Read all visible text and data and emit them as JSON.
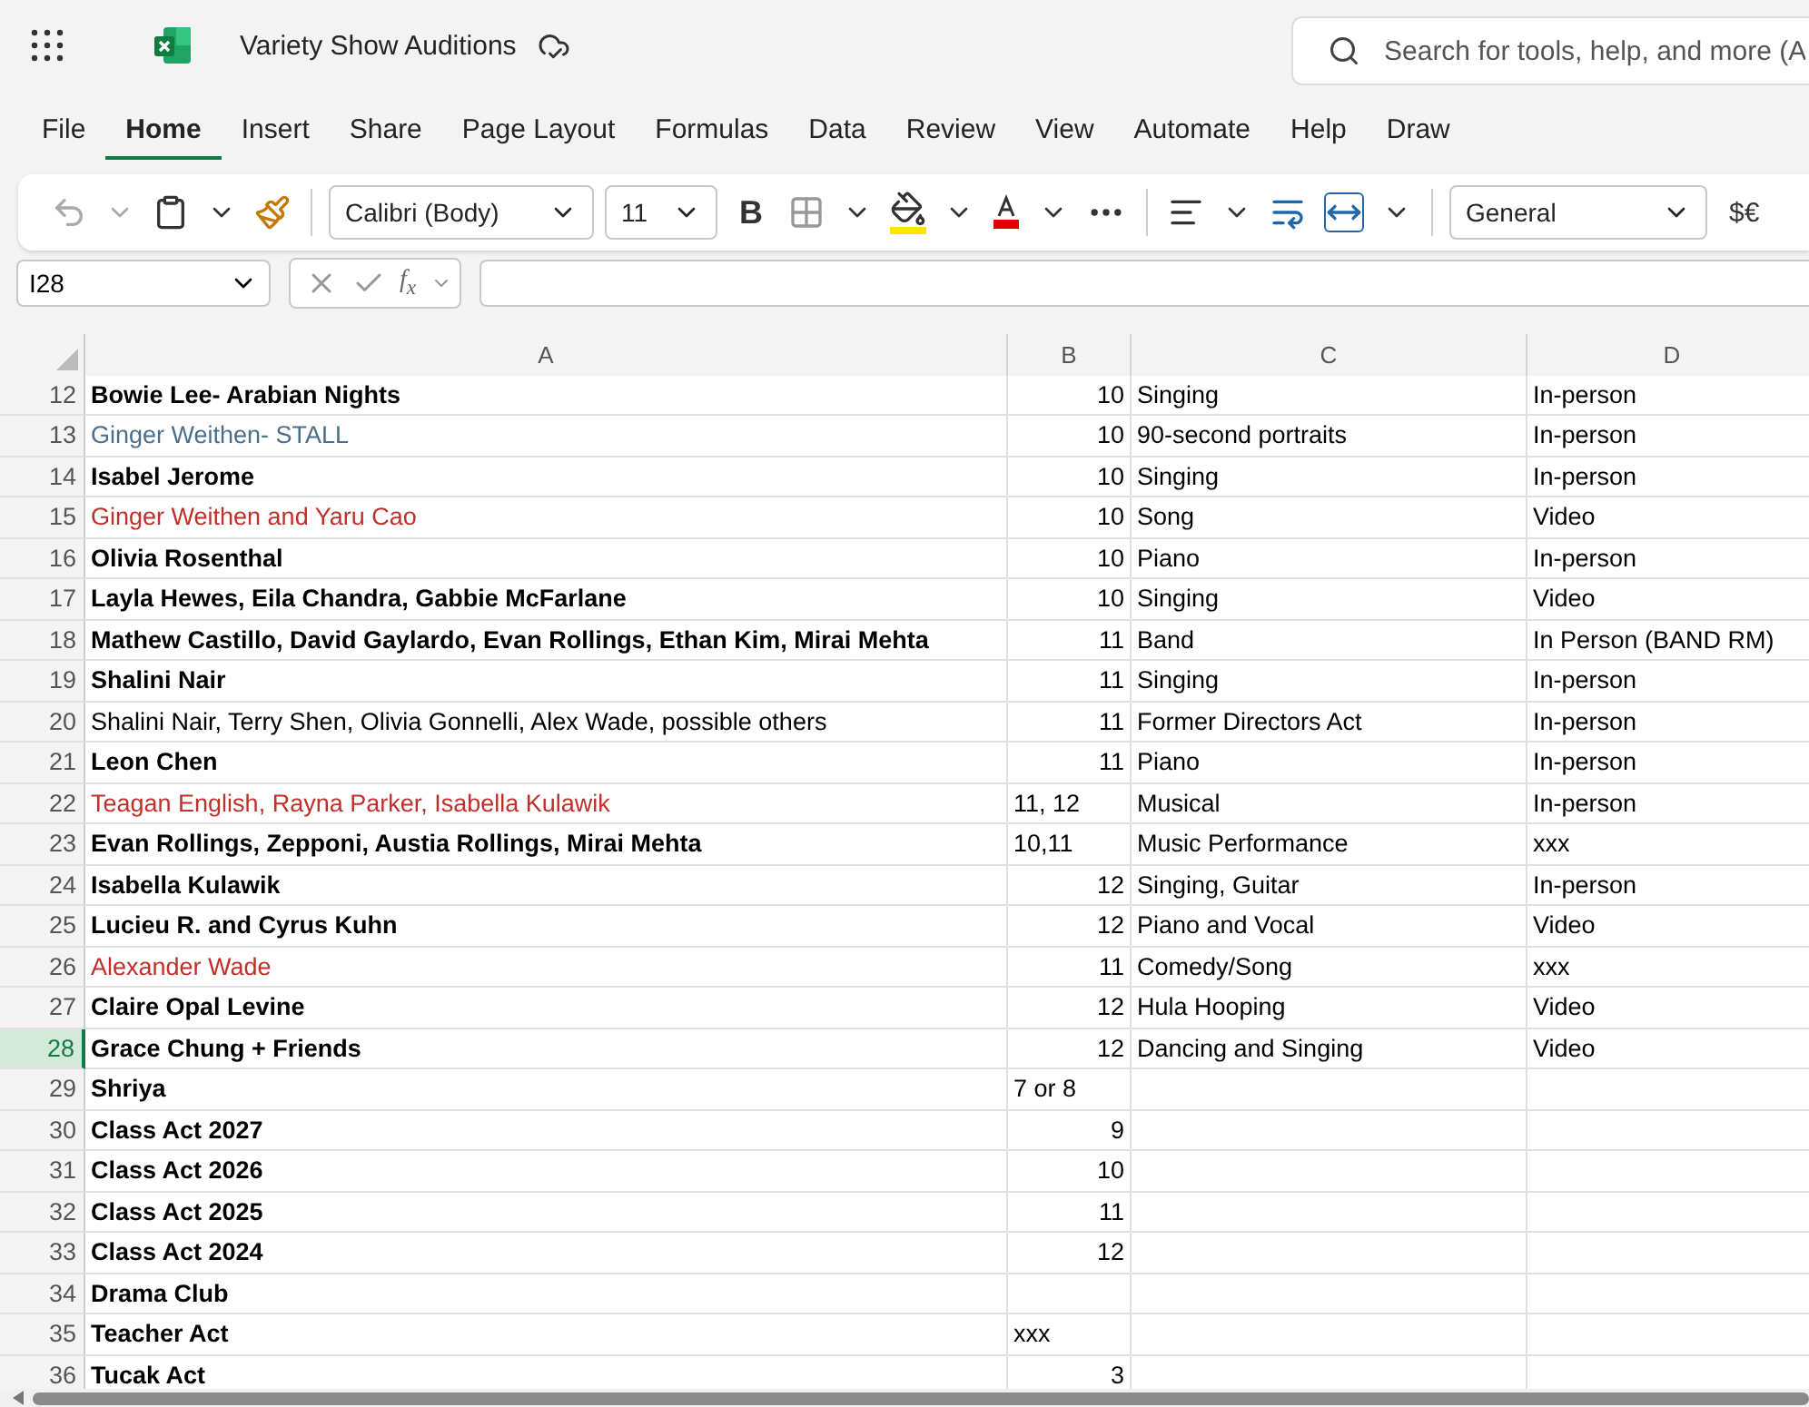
{
  "app": {
    "title": "Variety Show Auditions",
    "search": {
      "placeholder": "Search for tools, help, and more (A"
    }
  },
  "tabs": [
    {
      "label": "File",
      "selected": false
    },
    {
      "label": "Home",
      "selected": true
    },
    {
      "label": "Insert",
      "selected": false
    },
    {
      "label": "Share",
      "selected": false
    },
    {
      "label": "Page Layout",
      "selected": false
    },
    {
      "label": "Formulas",
      "selected": false
    },
    {
      "label": "Data",
      "selected": false
    },
    {
      "label": "Review",
      "selected": false
    },
    {
      "label": "View",
      "selected": false
    },
    {
      "label": "Automate",
      "selected": false
    },
    {
      "label": "Help",
      "selected": false
    },
    {
      "label": "Draw",
      "selected": false
    }
  ],
  "ribbon": {
    "font": "Calibri (Body)",
    "size": "11",
    "bold": "B",
    "number_format": "General",
    "currency": "$€"
  },
  "formula_bar": {
    "name_box": "I28",
    "function_label": "f$_{x}$"
  },
  "columns": [
    "A",
    "B",
    "C",
    "D"
  ],
  "rows": [
    {
      "number": "12",
      "selected": false,
      "cells": [
        {
          "text": "Bowie Lee- Arabian Nights",
          "bold": true
        },
        {
          "text": "10",
          "kind": "number"
        },
        {
          "text": "Singing"
        },
        {
          "text": "In-person"
        }
      ]
    },
    {
      "number": "13",
      "selected": false,
      "cells": [
        {
          "text": "Ginger Weithen- STALL",
          "bold": false,
          "color": "#4a6f8a"
        },
        {
          "text": "10",
          "kind": "number"
        },
        {
          "text": "90-second portraits"
        },
        {
          "text": "In-person"
        }
      ]
    },
    {
      "number": "14",
      "selected": false,
      "cells": [
        {
          "text": "Isabel Jerome",
          "bold": true
        },
        {
          "text": "10",
          "kind": "number"
        },
        {
          "text": "Singing"
        },
        {
          "text": "In-person"
        }
      ]
    },
    {
      "number": "15",
      "selected": false,
      "cells": [
        {
          "text": "Ginger Weithen and Yaru Cao",
          "bold": false,
          "color": "#c0302b"
        },
        {
          "text": "10",
          "kind": "number"
        },
        {
          "text": "Song"
        },
        {
          "text": "Video"
        }
      ]
    },
    {
      "number": "16",
      "selected": false,
      "cells": [
        {
          "text": "Olivia Rosenthal",
          "bold": true
        },
        {
          "text": "10",
          "kind": "number"
        },
        {
          "text": "Piano"
        },
        {
          "text": "In-person"
        }
      ]
    },
    {
      "number": "17",
      "selected": false,
      "cells": [
        {
          "text": "Layla Hewes, Eila Chandra, Gabbie McFarlane",
          "bold": true
        },
        {
          "text": "10",
          "kind": "number"
        },
        {
          "text": "Singing"
        },
        {
          "text": "Video"
        }
      ]
    },
    {
      "number": "18",
      "selected": false,
      "cells": [
        {
          "text": "Mathew Castillo, David Gaylardo, Evan Rollings, Ethan Kim, Mirai Mehta",
          "bold": true
        },
        {
          "text": "11",
          "kind": "number"
        },
        {
          "text": "Band"
        },
        {
          "text": "In Person (BAND RM)"
        }
      ]
    },
    {
      "number": "19",
      "selected": false,
      "cells": [
        {
          "text": "Shalini Nair",
          "bold": true
        },
        {
          "text": "11",
          "kind": "number"
        },
        {
          "text": "Singing"
        },
        {
          "text": "In-person"
        }
      ]
    },
    {
      "number": "20",
      "selected": false,
      "cells": [
        {
          "text": "Shalini Nair, Terry Shen, Olivia Gonnelli, Alex Wade, possible others",
          "bold": false
        },
        {
          "text": "11",
          "kind": "number"
        },
        {
          "text": "Former Directors Act"
        },
        {
          "text": "In-person"
        }
      ]
    },
    {
      "number": "21",
      "selected": false,
      "cells": [
        {
          "text": "Leon Chen",
          "bold": true
        },
        {
          "text": "11",
          "kind": "number"
        },
        {
          "text": "Piano"
        },
        {
          "text": "In-person"
        }
      ]
    },
    {
      "number": "22",
      "selected": false,
      "cells": [
        {
          "text": "Teagan English, Rayna Parker, Isabella Kulawik",
          "bold": false,
          "color": "#c0302b"
        },
        {
          "text": "11, 12"
        },
        {
          "text": "Musical"
        },
        {
          "text": "In-person"
        }
      ]
    },
    {
      "number": "23",
      "selected": false,
      "cells": [
        {
          "text": "Evan Rollings, Zepponi, Austia Rollings, Mirai Mehta",
          "bold": true
        },
        {
          "text": "10,11"
        },
        {
          "text": "Music Performance"
        },
        {
          "text": "xxx"
        }
      ]
    },
    {
      "number": "24",
      "selected": false,
      "cells": [
        {
          "text": "Isabella Kulawik",
          "bold": true
        },
        {
          "text": "12",
          "kind": "number"
        },
        {
          "text": "Singing, Guitar"
        },
        {
          "text": "In-person"
        }
      ]
    },
    {
      "number": "25",
      "selected": false,
      "cells": [
        {
          "text": "Lucieu R. and Cyrus Kuhn",
          "bold": true
        },
        {
          "text": "12",
          "kind": "number"
        },
        {
          "text": "Piano and Vocal"
        },
        {
          "text": "Video"
        }
      ]
    },
    {
      "number": "26",
      "selected": false,
      "cells": [
        {
          "text": "Alexander Wade",
          "bold": false,
          "color": "#c0302b"
        },
        {
          "text": "11",
          "kind": "number"
        },
        {
          "text": "Comedy/Song"
        },
        {
          "text": "xxx"
        }
      ]
    },
    {
      "number": "27",
      "selected": false,
      "cells": [
        {
          "text": "Claire Opal Levine",
          "bold": true
        },
        {
          "text": "12",
          "kind": "number"
        },
        {
          "text": "Hula Hooping"
        },
        {
          "text": "Video"
        }
      ]
    },
    {
      "number": "28",
      "selected": true,
      "cells": [
        {
          "text": "Grace Chung + Friends",
          "bold": true
        },
        {
          "text": "12",
          "kind": "number"
        },
        {
          "text": "Dancing and Singing"
        },
        {
          "text": "Video"
        }
      ]
    },
    {
      "number": "29",
      "selected": false,
      "cells": [
        {
          "text": "Shriya",
          "bold": true
        },
        {
          "text": "7 or 8"
        }
      ]
    },
    {
      "number": "30",
      "selected": false,
      "cells": [
        {
          "text": "Class Act 2027",
          "bold": true
        },
        {
          "text": "9",
          "kind": "number"
        }
      ]
    },
    {
      "number": "31",
      "selected": false,
      "cells": [
        {
          "text": "Class Act 2026",
          "bold": true
        },
        {
          "text": "10",
          "kind": "number"
        }
      ]
    },
    {
      "number": "32",
      "selected": false,
      "cells": [
        {
          "text": "Class Act 2025",
          "bold": true
        },
        {
          "text": "11",
          "kind": "number"
        }
      ]
    },
    {
      "number": "33",
      "selected": false,
      "cells": [
        {
          "text": "Class Act 2024",
          "bold": true
        },
        {
          "text": "12",
          "kind": "number"
        }
      ]
    },
    {
      "number": "34",
      "selected": false,
      "cells": [
        {
          "text": "Drama Club",
          "bold": true
        }
      ]
    },
    {
      "number": "35",
      "selected": false,
      "cells": [
        {
          "text": "Teacher Act",
          "bold": true
        },
        {
          "text": "xxx"
        }
      ]
    },
    {
      "number": "36",
      "selected": false,
      "cells": [
        {
          "text": "Tucak Act",
          "bold": true
        },
        {
          "text": "3",
          "kind": "number"
        }
      ]
    }
  ]
}
